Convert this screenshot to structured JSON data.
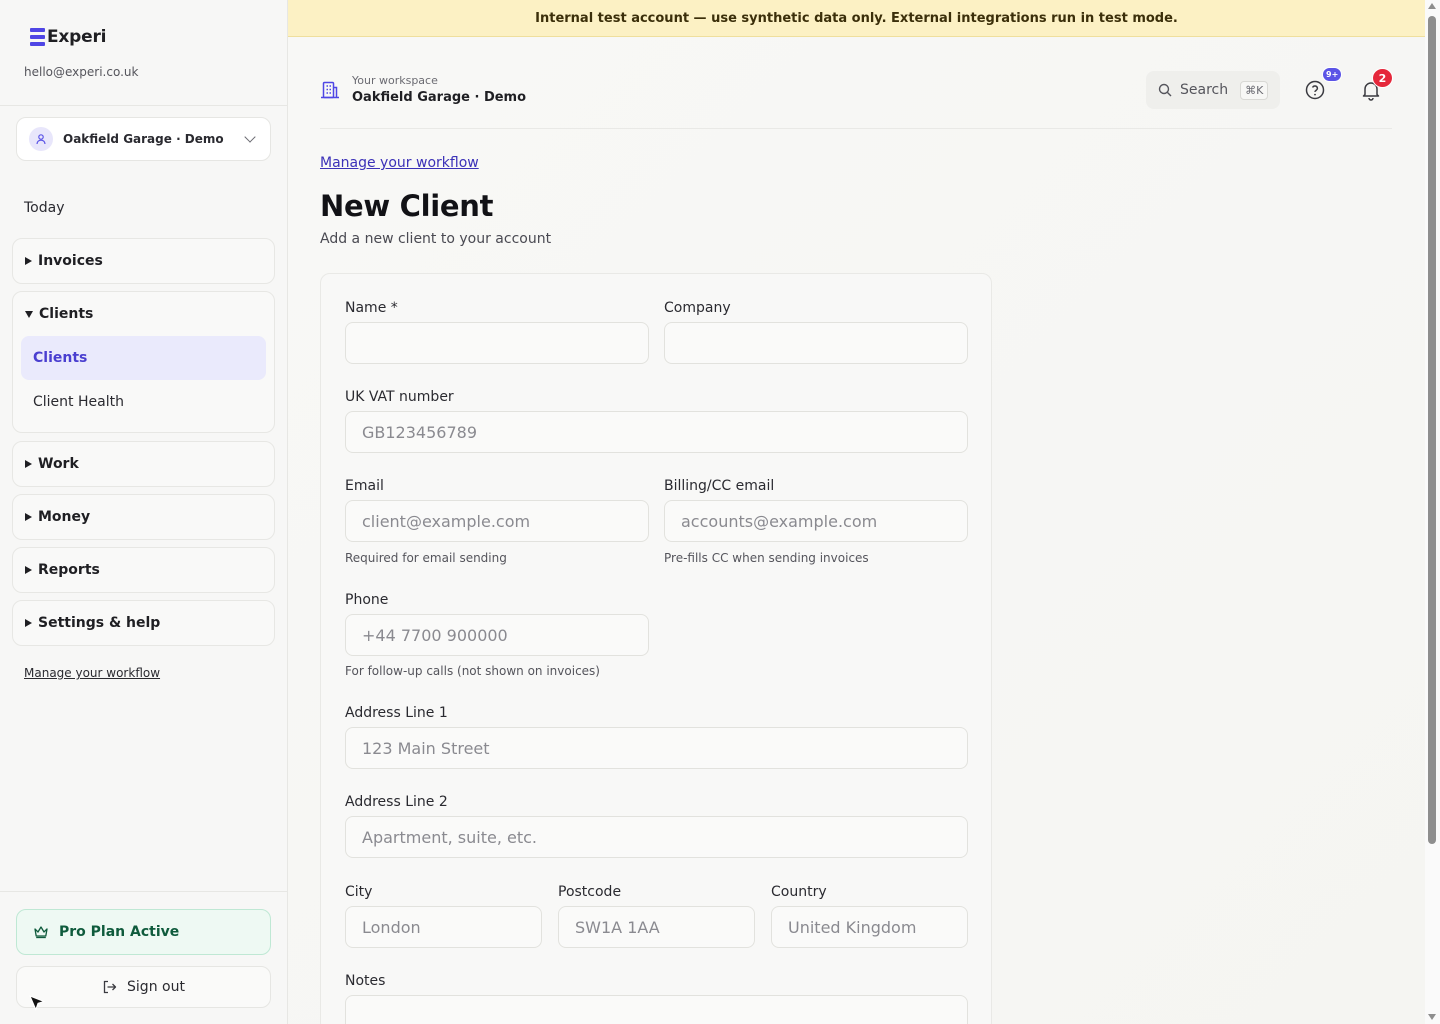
{
  "brand": {
    "name": "Experi",
    "email": "hello@experi.co.uk",
    "accent": "#4f46e5"
  },
  "workspace_switcher": {
    "label": "Oakfield Garage · Demo"
  },
  "sidebar": {
    "today": "Today",
    "groups": [
      {
        "label": "Invoices",
        "expanded": false
      },
      {
        "label": "Clients",
        "expanded": true,
        "items": [
          {
            "label": "Clients",
            "active": true
          },
          {
            "label": "Client Health",
            "active": false
          }
        ]
      },
      {
        "label": "Work",
        "expanded": false
      },
      {
        "label": "Money",
        "expanded": false
      },
      {
        "label": "Reports",
        "expanded": false
      },
      {
        "label": "Settings & help",
        "expanded": false
      }
    ],
    "workflow_link": "Manage your workflow",
    "pro_plan": "Pro Plan Active",
    "sign_out": "Sign out"
  },
  "banner": {
    "text": "Internal test account — use synthetic data only. External integrations run in test mode.",
    "color": "#fcf1c4"
  },
  "header": {
    "caption": "Your workspace",
    "title": "Oakfield Garage · Demo",
    "search_label": "Search",
    "search_shortcut": "⌘K",
    "help_badge": "9+",
    "notifications_badge": "2"
  },
  "page": {
    "breadcrumb": "Manage your workflow",
    "title": "New Client",
    "subtitle": "Add a new client to your account"
  },
  "form": {
    "name": {
      "label": "Name *",
      "value": "",
      "placeholder": ""
    },
    "company": {
      "label": "Company",
      "value": "",
      "placeholder": ""
    },
    "vat": {
      "label": "UK VAT number",
      "placeholder": "GB123456789"
    },
    "email": {
      "label": "Email",
      "placeholder": "client@example.com",
      "hint": "Required for email sending"
    },
    "billing_email": {
      "label": "Billing/CC email",
      "placeholder": "accounts@example.com",
      "hint": "Pre-fills CC when sending invoices"
    },
    "phone": {
      "label": "Phone",
      "placeholder": "+44 7700 900000",
      "hint": "For follow-up calls (not shown on invoices)"
    },
    "address1": {
      "label": "Address Line 1",
      "placeholder": "123 Main Street"
    },
    "address2": {
      "label": "Address Line 2",
      "placeholder": "Apartment, suite, etc."
    },
    "city": {
      "label": "City",
      "placeholder": "London"
    },
    "postcode": {
      "label": "Postcode",
      "placeholder": "SW1A 1AA"
    },
    "country": {
      "label": "Country",
      "placeholder": "United Kingdom"
    },
    "notes": {
      "label": "Notes"
    }
  }
}
